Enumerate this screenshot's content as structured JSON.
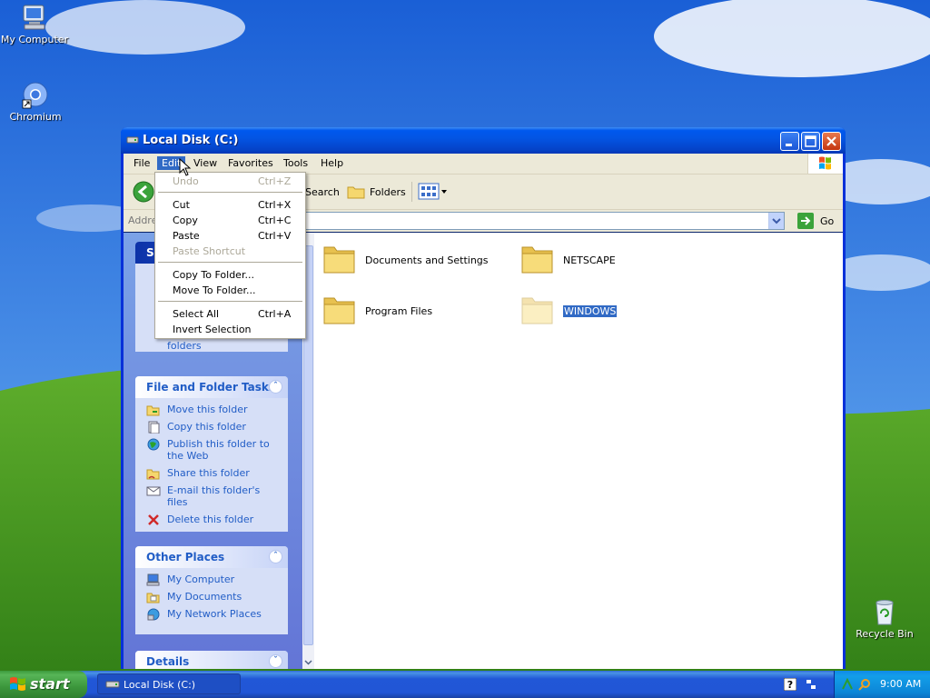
{
  "desktop": {
    "icons": [
      {
        "label": "My Computer"
      },
      {
        "label": "Chromium"
      },
      {
        "label": "Recycle Bin"
      }
    ]
  },
  "window": {
    "title": "Local Disk (C:)",
    "menu": [
      "File",
      "Edit",
      "View",
      "Favorites",
      "Tools",
      "Help"
    ],
    "toolbar": {
      "search_label": "Search",
      "folders_label": "Folders"
    },
    "address": {
      "label": "Addre",
      "go_label": "Go"
    },
    "panels": {
      "system": {
        "title": "S",
        "trailing_text": "folders"
      },
      "file_tasks": {
        "title": "File and Folder Tasks",
        "items": [
          "Move this folder",
          "Copy this folder",
          "Publish this folder to the Web",
          "Share this folder",
          "E-mail this folder's files",
          "Delete this folder"
        ]
      },
      "other_places": {
        "title": "Other Places",
        "items": [
          "My Computer",
          "My Documents",
          "My Network Places"
        ]
      },
      "details": {
        "title": "Details"
      }
    },
    "folders": [
      {
        "name": "Documents and Settings",
        "selected": false
      },
      {
        "name": "NETSCAPE",
        "selected": false
      },
      {
        "name": "Program Files",
        "selected": false
      },
      {
        "name": "WINDOWS",
        "selected": true
      }
    ]
  },
  "edit_menu": {
    "items": [
      {
        "label": "Undo",
        "shortcut": "Ctrl+Z",
        "disabled": true
      },
      {
        "label": "Cut",
        "shortcut": "Ctrl+X",
        "disabled": false
      },
      {
        "label": "Copy",
        "shortcut": "Ctrl+C",
        "disabled": false
      },
      {
        "label": "Paste",
        "shortcut": "Ctrl+V",
        "disabled": false
      },
      {
        "label": "Paste Shortcut",
        "shortcut": "",
        "disabled": true
      },
      {
        "label": "Copy To Folder...",
        "shortcut": "",
        "disabled": false
      },
      {
        "label": "Move To Folder...",
        "shortcut": "",
        "disabled": false
      },
      {
        "label": "Select All",
        "shortcut": "Ctrl+A",
        "disabled": false
      },
      {
        "label": "Invert Selection",
        "shortcut": "",
        "disabled": false
      }
    ]
  },
  "taskbar": {
    "start_label": "start",
    "task_label": "Local Disk (C:)",
    "clock": "9:00 AM"
  }
}
